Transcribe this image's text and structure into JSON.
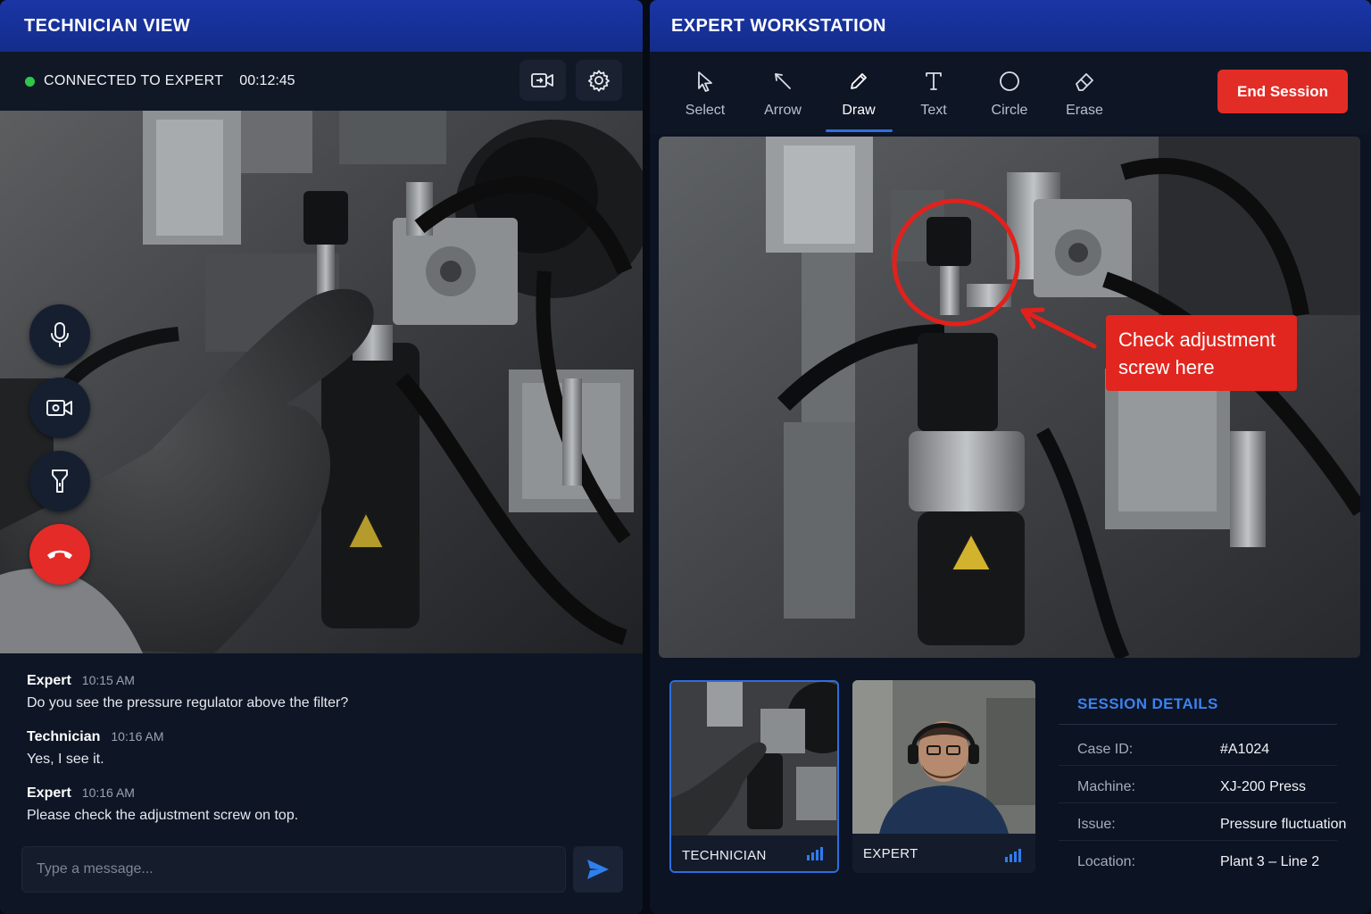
{
  "technician_view": {
    "title": "TECHNICIAN VIEW",
    "status": "CONNECTED TO EXPERT",
    "timer": "00:12:45",
    "header_buttons": [
      "camera-switch-icon",
      "gear-icon"
    ],
    "side_controls": [
      "microphone-icon",
      "video-camera-icon",
      "flashlight-icon",
      "hang-up-icon"
    ],
    "messages": [
      {
        "sender": "Expert",
        "time": "10:15 AM",
        "text": "Do you see the pressure regulator above the filter?"
      },
      {
        "sender": "Technician",
        "time": "10:16 AM",
        "text": "Yes, I see it."
      },
      {
        "sender": "Expert",
        "time": "10:16 AM",
        "text": "Please check the adjustment screw on top."
      }
    ],
    "composer_placeholder": "Type a message...",
    "send_icon": "send-icon"
  },
  "expert_workstation": {
    "title": "EXPERT WORKSTATION",
    "tools": [
      {
        "label": "Select",
        "icon": "pointer-icon"
      },
      {
        "label": "Arrow",
        "icon": "arrow-tool-icon"
      },
      {
        "label": "Draw",
        "icon": "pencil-icon"
      },
      {
        "label": "Text",
        "icon": "text-icon"
      },
      {
        "label": "Circle",
        "icon": "circle-icon"
      },
      {
        "label": "Erase",
        "icon": "eraser-icon"
      }
    ],
    "active_tool": "Draw",
    "end_session_label": "End Session",
    "annotation_callout": "Check adjustment screw here",
    "participants": [
      {
        "label": "TECHNICIAN",
        "active": true
      },
      {
        "label": "EXPERT",
        "active": false
      }
    ],
    "session_details": {
      "title": "SESSION DETAILS",
      "rows": [
        {
          "key": "Case ID:",
          "value": "#A1024"
        },
        {
          "key": "Machine:",
          "value": "XJ-200 Press"
        },
        {
          "key": "Issue:",
          "value": "Pressure fluctuation"
        },
        {
          "key": "Location:",
          "value": "Plant 3 – Line 2"
        }
      ]
    }
  },
  "colors": {
    "header_blue": "#1a36a6",
    "accent_blue": "#2f6fe0",
    "danger_red": "#e22d26",
    "status_green": "#2fc74a",
    "panel_bg": "#0d1524"
  }
}
